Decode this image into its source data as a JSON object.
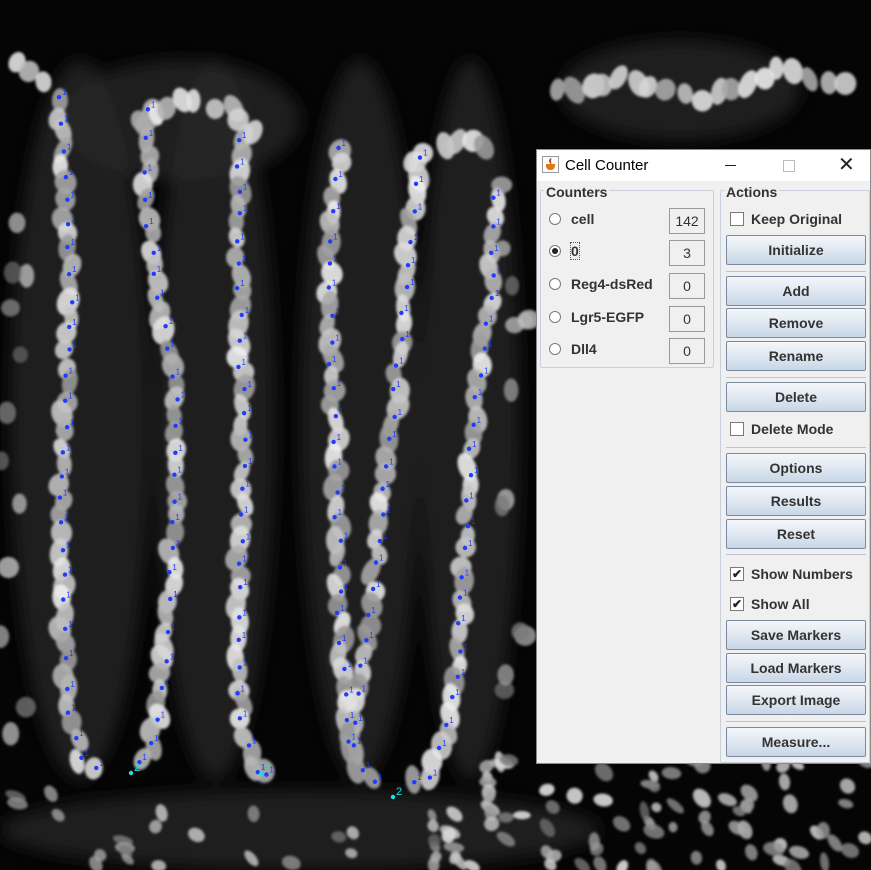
{
  "window": {
    "title": "Cell Counter"
  },
  "counters": {
    "label": "Counters",
    "items": [
      {
        "name": "cell",
        "count": "142",
        "selected": false
      },
      {
        "name": "0",
        "count": "3",
        "selected": true
      },
      {
        "name": "Reg4-dsRed",
        "count": "0",
        "selected": false
      },
      {
        "name": "Lgr5-EGFP",
        "count": "0",
        "selected": false
      },
      {
        "name": "Dll4",
        "count": "0",
        "selected": false
      }
    ]
  },
  "actions": {
    "label": "Actions",
    "keep_original": {
      "label": "Keep Original",
      "checked": false
    },
    "initialize": "Initialize",
    "add": "Add",
    "remove": "Remove",
    "rename": "Rename",
    "delete": "Delete",
    "delete_mode": {
      "label": "Delete Mode",
      "checked": false
    },
    "options": "Options",
    "results": "Results",
    "reset": "Reset",
    "show_numbers": {
      "label": "Show Numbers",
      "checked": true
    },
    "show_all": {
      "label": "Show All",
      "checked": true
    },
    "save_markers": "Save Markers",
    "load_markers": "Load Markers",
    "export_image": "Export Image",
    "measure": "Measure..."
  },
  "image": {
    "marker_colors": {
      "type1": "#1f3cff",
      "type2": "#19e0e6"
    },
    "marker_labels": {
      "type1": "1",
      "type2": "2"
    }
  }
}
